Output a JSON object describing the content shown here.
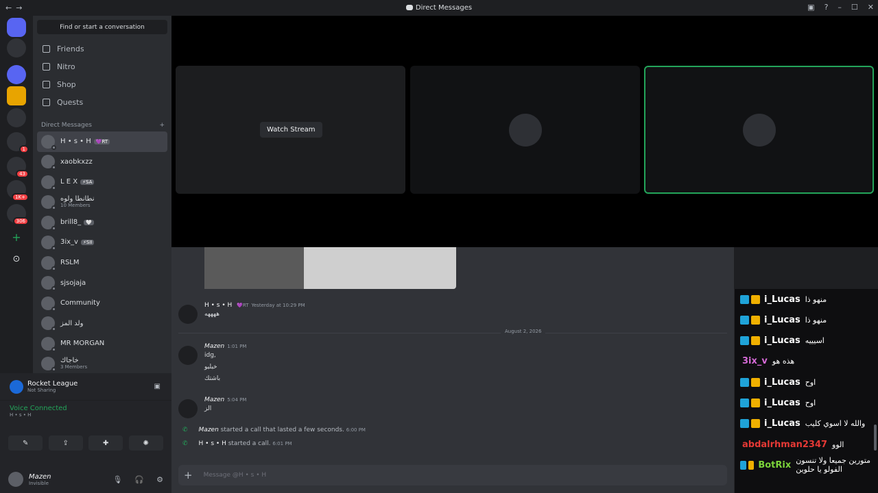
{
  "window": {
    "title": "Direct Messages",
    "back": "←",
    "forward": "→",
    "controls": [
      "▣",
      "?",
      "–",
      "☐",
      "✕"
    ]
  },
  "guilds": [
    {
      "name": "discord-home-icon",
      "badge": ""
    },
    {
      "name": "server-1",
      "badge": ""
    },
    {
      "name": "server-2",
      "badge": ""
    },
    {
      "name": "server-3",
      "badge": ""
    },
    {
      "name": "server-4",
      "badge": ""
    },
    {
      "name": "server-5",
      "badge": "1"
    },
    {
      "name": "server-6",
      "badge": "43"
    },
    {
      "name": "server-7",
      "badge": "1K+"
    },
    {
      "name": "server-8",
      "badge": "306"
    }
  ],
  "sidebar": {
    "search_placeholder": "Find or start a conversation",
    "nav": [
      "Friends",
      "Nitro",
      "Shop",
      "Quests"
    ],
    "dm_header": "Direct Messages",
    "dm_add": "+",
    "dms": [
      {
        "name": "H • s • H",
        "tag": "💜RT",
        "sub": "",
        "active": true
      },
      {
        "name": "xaobkxzz",
        "tag": "",
        "sub": ""
      },
      {
        "name": "L E X",
        "tag": "⚡SA",
        "sub": ""
      },
      {
        "name": "نطانطا ولوه",
        "tag": "",
        "sub": "10 Members"
      },
      {
        "name": "brill8_",
        "tag": "🤍",
        "sub": ""
      },
      {
        "name": "3ix_v",
        "tag": "⚡SII",
        "sub": ""
      },
      {
        "name": "RSLM",
        "tag": "",
        "sub": ""
      },
      {
        "name": "sjsojaja",
        "tag": "",
        "sub": ""
      },
      {
        "name": "Community",
        "tag": "",
        "sub": ""
      },
      {
        "name": "ولد المز",
        "tag": "",
        "sub": ""
      },
      {
        "name": "MR MORGAN",
        "tag": "",
        "sub": ""
      },
      {
        "name": "خاجاك",
        "tag": "",
        "sub": "3 Members"
      }
    ]
  },
  "activity": {
    "title": "Rocket League",
    "status": "Not Sharing"
  },
  "voice": {
    "label": "Voice Connected",
    "channel": "H • s • H"
  },
  "user": {
    "name": "Mazen",
    "status": "Invisible"
  },
  "stage": {
    "watch_label": "Watch Stream"
  },
  "chat": {
    "date_divider": "August 2, 2026",
    "messages": [
      {
        "author": "H • s • H",
        "tag": "💜RT",
        "time": "Yesterday at 10:29 PM",
        "lines": [
          "ههههه"
        ]
      },
      {
        "author": "Mazen",
        "time": "1:01 PM",
        "lines": [
          "idg,",
          "خيليو",
          "باشتك"
        ]
      },
      {
        "author": "Mazen",
        "time": "5:04 PM",
        "lines": [
          "الز"
        ]
      }
    ],
    "system": [
      {
        "author": "Mazen",
        "text": "started a call that lasted a few seconds.",
        "time": "6:00 PM"
      },
      {
        "author": "H • s • H",
        "text": "started a call.",
        "time": "6:01 PM"
      }
    ],
    "composer_placeholder": "Message @H • s • H"
  },
  "kick_chat": [
    {
      "user": "i_Lucas",
      "color": "#ffffff",
      "text": "منهو ذا",
      "badges": true
    },
    {
      "user": "i_Lucas",
      "color": "#ffffff",
      "text": "منهو ذا",
      "badges": true
    },
    {
      "user": "i_Lucas",
      "color": "#ffffff",
      "text": "اسيييه",
      "badges": true
    },
    {
      "user": "3ix_v",
      "color": "#d56ad6",
      "text": "هذه هو",
      "badges": false
    },
    {
      "user": "i_Lucas",
      "color": "#ffffff",
      "text": "اوح",
      "badges": true
    },
    {
      "user": "i_Lucas",
      "color": "#ffffff",
      "text": "اوح",
      "badges": true
    },
    {
      "user": "i_Lucas",
      "color": "#ffffff",
      "text": "والله لا اسوي كليب",
      "badges": true
    },
    {
      "user": "abdalrhman2347",
      "color": "#e53935",
      "text": "الوو",
      "badges": false
    },
    {
      "user": "BotRix",
      "color": "#7bd43a",
      "text": "متورين جميعا ولا تنسون الفولو يا حلوين",
      "badges": true
    }
  ],
  "colors": {
    "accent": "#5865f2",
    "online": "#23a55a",
    "danger": "#f23f43"
  }
}
